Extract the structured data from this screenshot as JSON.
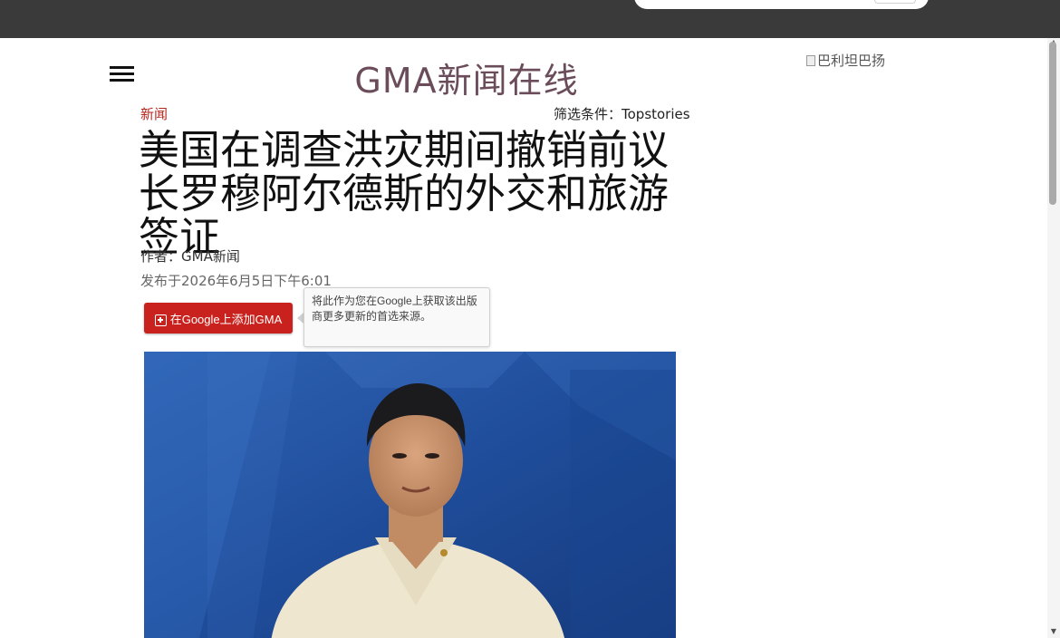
{
  "site": {
    "title": "GMA新闻在线",
    "ad_alt": "巴利坦巴扬"
  },
  "article": {
    "section": "新闻",
    "filter": "筛选条件：Topstories",
    "headline": "美国在调查洪灾期间撤销前议长罗穆阿尔德斯的外交和旅游签证",
    "author": "作者：GMA新闻",
    "published": "发布于2026年6月5日下午6:01"
  },
  "google_button": {
    "label": "在Google上添加GMA"
  },
  "tooltip": {
    "text": "将此作为您在Google上获取该出版商更多更新的首选来源。"
  },
  "icons": {
    "menu": "hamburger-menu-icon",
    "google_add": "plus-square-icon",
    "broken_image": "broken-image-icon"
  },
  "colors": {
    "site_title": "#6b4c5a",
    "section_link": "#b3261e",
    "button": "#c9211d",
    "top_bar": "#3a3a3a"
  }
}
